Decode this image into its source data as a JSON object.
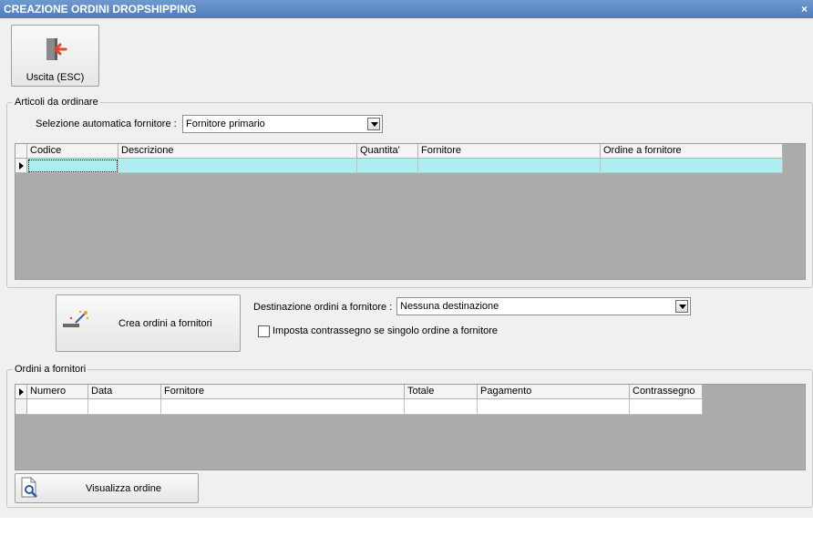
{
  "window": {
    "title": "CREAZIONE ORDINI DROPSHIPPING",
    "close_glyph": "×"
  },
  "toolbar": {
    "exit_label": "Uscita (ESC)",
    "exit_icon": "exit-door-icon"
  },
  "articoli": {
    "legend": "Articoli da ordinare",
    "supplier_select_label": "Selezione automatica fornitore :",
    "supplier_select_value": "Fornitore primario",
    "columns": [
      "Codice",
      "Descrizione",
      "Quantita'",
      "Fornitore",
      "Ordine a fornitore"
    ],
    "row_highlight_color": "#aeeef0"
  },
  "actions": {
    "create_label": "Crea ordini a fornitori",
    "create_icon": "magic-wand-icon",
    "destination_label": "Destinazione ordini a fornitore :",
    "destination_value": "Nessuna destinazione",
    "cod_checkbox_label": "Imposta contrassegno se singolo ordine a fornitore",
    "cod_checked": false
  },
  "ordini": {
    "legend": "Ordini a fornitori",
    "columns": [
      "Numero",
      "Data",
      "Fornitore",
      "Totale",
      "Pagamento",
      "Contrassegno"
    ],
    "view_label": "Visualizza ordine",
    "view_icon": "document-search-icon"
  }
}
